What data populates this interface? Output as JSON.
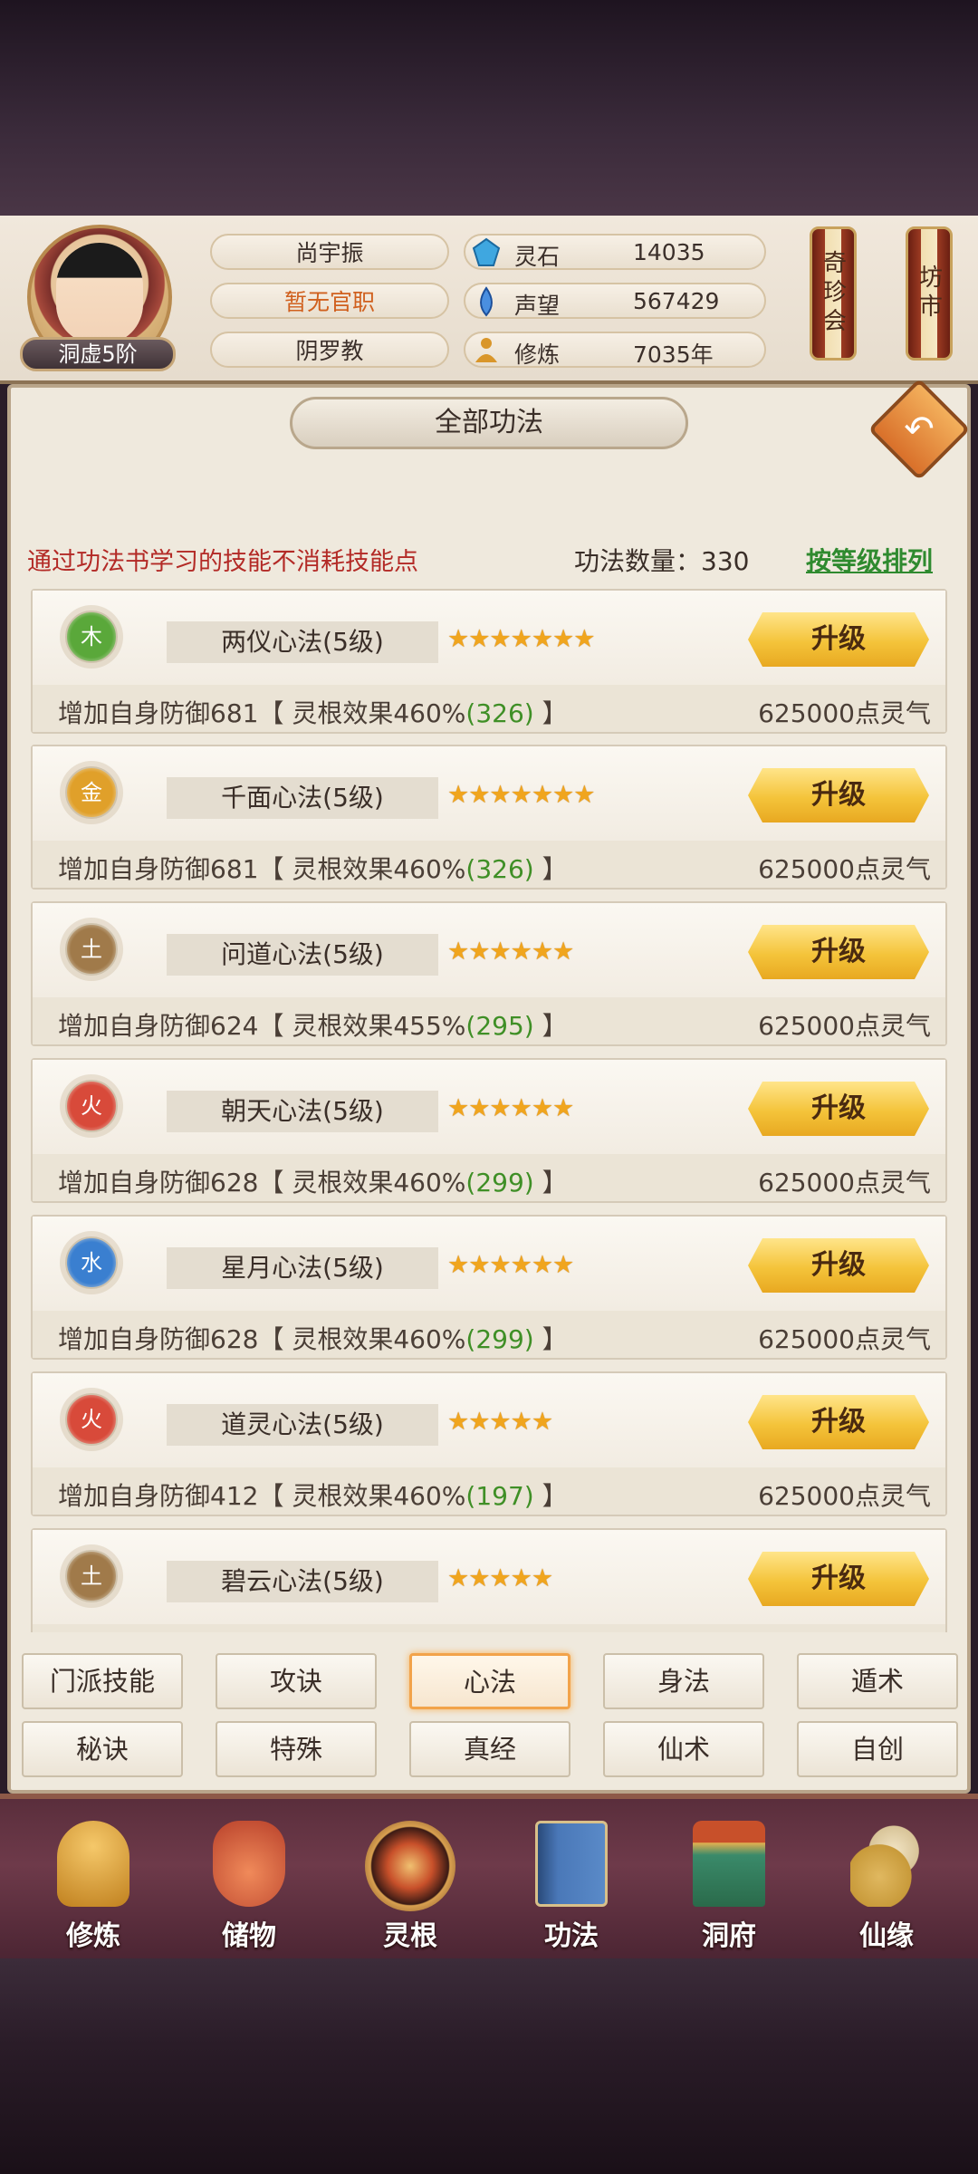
{
  "player": {
    "name": "尚宇振",
    "rank": "洞虚5阶",
    "title": "暂无官职",
    "sect": "阴罗教"
  },
  "resources": [
    {
      "label": "灵石",
      "value": "14035",
      "icon": "spirit-stone-icon",
      "color": "#3fa7e0"
    },
    {
      "label": "声望",
      "value": "567429",
      "icon": "reputation-icon",
      "color": "#4a8fe0"
    },
    {
      "label": "修炼",
      "value": "7035年",
      "icon": "meditation-icon",
      "color": "#d9962a"
    }
  ],
  "side_buttons": {
    "qizhen": "奇珍会",
    "fangshi": "坊市"
  },
  "panel": {
    "title": "全部功法",
    "hint": "通过功法书学习的技能不消耗技能点",
    "count": "功法数量：330",
    "sort": "按等级排列"
  },
  "skills": [
    {
      "element": "木",
      "element_color": "#5aa83a",
      "name": "两仪心法(5级)",
      "stars": 7,
      "stars_text": "★★★★★★★",
      "button": "升级",
      "desc_prefix": "增加自身防御681【 灵根效果460%",
      "desc_green": "(326)",
      "desc_suffix": " 】",
      "cost": "625000点灵气"
    },
    {
      "element": "金",
      "element_color": "#e0a02a",
      "name": "千面心法(5级)",
      "stars": 7,
      "stars_text": "★★★★★★★",
      "button": "升级",
      "desc_prefix": "增加自身防御681【 灵根效果460%",
      "desc_green": "(326)",
      "desc_suffix": " 】",
      "cost": "625000点灵气"
    },
    {
      "element": "土",
      "element_color": "#a07a4a",
      "name": "问道心法(5级)",
      "stars": 6,
      "stars_text": "★★★★★★",
      "button": "升级",
      "desc_prefix": "增加自身防御624【 灵根效果455%",
      "desc_green": "(295)",
      "desc_suffix": " 】",
      "cost": "625000点灵气"
    },
    {
      "element": "火",
      "element_color": "#d84a3a",
      "name": "朝天心法(5级)",
      "stars": 6,
      "stars_text": "★★★★★★",
      "button": "升级",
      "desc_prefix": "增加自身防御628【 灵根效果460%",
      "desc_green": "(299)",
      "desc_suffix": " 】",
      "cost": "625000点灵气"
    },
    {
      "element": "水",
      "element_color": "#3a7fd0",
      "name": "星月心法(5级)",
      "stars": 6,
      "stars_text": "★★★★★★",
      "button": "升级",
      "desc_prefix": "增加自身防御628【 灵根效果460%",
      "desc_green": "(299)",
      "desc_suffix": " 】",
      "cost": "625000点灵气"
    },
    {
      "element": "火",
      "element_color": "#d84a3a",
      "name": "道灵心法(5级)",
      "stars": 5,
      "stars_text": "★★★★★",
      "button": "升级",
      "desc_prefix": "增加自身防御412【 灵根效果460%",
      "desc_green": "(197)",
      "desc_suffix": " 】",
      "cost": "625000点灵气"
    },
    {
      "element": "土",
      "element_color": "#a07a4a",
      "name": "碧云心法(5级)",
      "stars": 5,
      "stars_text": "★★★★★",
      "button": "升级",
      "desc_prefix": "",
      "desc_green": "",
      "desc_suffix": "",
      "cost": ""
    }
  ],
  "tabs_row1": [
    "门派技能",
    "攻诀",
    "心法",
    "身法",
    "遁术"
  ],
  "tabs_row2": [
    "秘诀",
    "特殊",
    "真经",
    "仙术",
    "自创"
  ],
  "active_tab": "心法",
  "nav": [
    {
      "label": "修炼",
      "icon": "cultivation-icon",
      "color": "#d9a03a"
    },
    {
      "label": "储物",
      "icon": "storage-bag-icon",
      "color": "#d8603a"
    },
    {
      "label": "灵根",
      "icon": "spirit-root-icon",
      "color": "#c8502a"
    },
    {
      "label": "功法",
      "icon": "skill-book-icon",
      "color": "#4a78b8"
    },
    {
      "label": "洞府",
      "icon": "cave-mansion-icon",
      "color": "#3a8a6a"
    },
    {
      "label": "仙缘",
      "icon": "immortal-fate-icon",
      "color": "#e0b860"
    }
  ]
}
